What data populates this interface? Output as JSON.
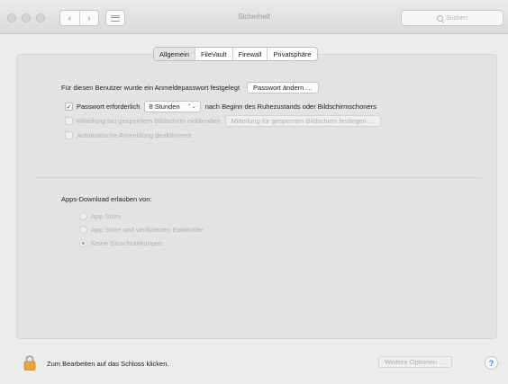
{
  "window": {
    "title": "Sicherheit"
  },
  "toolbar": {
    "back_glyph": "‹",
    "forward_glyph": "›"
  },
  "search": {
    "placeholder": "Suchen"
  },
  "tabs": [
    {
      "label": "Allgemein",
      "active": true
    },
    {
      "label": "FileVault",
      "active": false
    },
    {
      "label": "Firewall",
      "active": false
    },
    {
      "label": "Privatsphäre",
      "active": false
    }
  ],
  "general": {
    "password_set_text": "Für diesen Benutzer wurde ein Anmeldepasswort festgelegt",
    "change_password_button": "Passwort ändern …",
    "require_password": {
      "checked": true,
      "checkmark": "✓",
      "label": "Passwort erforderlich",
      "delay_value": "8 Stunden",
      "delay_arrows": "⌃⌄",
      "suffix": "nach Beginn des Ruhezustands oder Bildschirmschoners"
    },
    "lock_message": {
      "checked": false,
      "label": "Mitteilung bei gesperrtem Bildschirm einblenden",
      "button": "Mitteilung für gesperrten Bildschirm festlegen …"
    },
    "disable_autologin": {
      "checked": false,
      "label": "Automatische Anmeldung deaktivieren"
    }
  },
  "downloads": {
    "heading": "Apps-Download erlauben von:",
    "options": [
      {
        "label": "App Store",
        "selected": false
      },
      {
        "label": "App Store und verifizierten Entwickler",
        "selected": false
      },
      {
        "label": "Keine Einschränkungen",
        "selected": true
      }
    ]
  },
  "footer": {
    "lock_text": "Zum Bearbeiten auf das Schloss klicken.",
    "more_options_button": "Weitere Optionen …",
    "help_label": "?"
  },
  "colors": {
    "lock": "#e9a63a",
    "help": "#3a7cf0"
  }
}
